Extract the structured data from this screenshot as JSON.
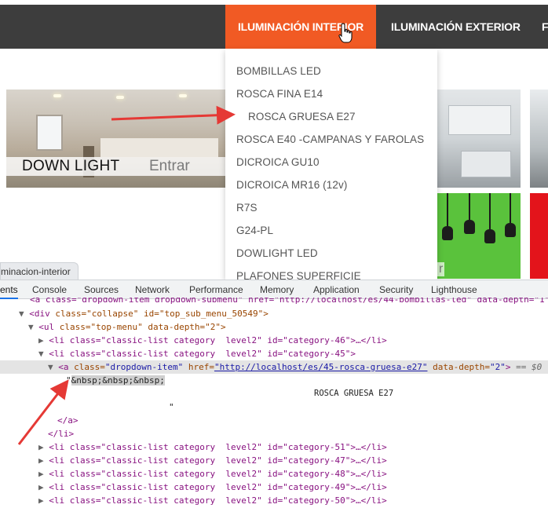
{
  "nav": {
    "items": [
      "ILUMINACIÓN INTERIOR",
      "ILUMINACIÓN EXTERIOR",
      "F"
    ],
    "active_color": "#f15a24",
    "bar_color": "#3d3d3d"
  },
  "tiles": {
    "downlight": {
      "title": "DOWN LIGHT",
      "enter": "Entrar"
    },
    "bulbs_caption": "r"
  },
  "dropdown": {
    "items": [
      "BOMBILLAS LED",
      "ROSCA FINA E14",
      "ROSCA GRUESA E27",
      "ROSCA E40 -CAMPANAS Y FAROLAS",
      "DICROICA GU10",
      "DICROICA MR16 (12v)",
      "R7S",
      "G24-PL",
      "DOWLIGHT LED",
      "PLAFONES SUPERFICIE"
    ]
  },
  "devtools": {
    "url_tab": "minacion-interior",
    "tabs": [
      "ents",
      "Console",
      "Sources",
      "Network",
      "Performance",
      "Memory",
      "Application",
      "Security",
      "Lighthouse"
    ],
    "lines": {
      "l0": "<a class=\"dropdown-item dropdown-submenu\" href=\"http://localhost/es/44-bombillas-led\" data-depth=\"1\" d",
      "l1_tag": "<div",
      "l1_attrs": " class=\"collapse\" id=\"top_sub_menu_50549\">",
      "l2_tag": "<ul",
      "l2_attrs": " class=\"top-menu\" data-depth=\"2\">",
      "li46": "<li class=\"classic-list category  level2\" id=\"category-46\">…</li>",
      "li45": "<li class=\"classic-list category  level2\" id=\"category-45\">",
      "a_open": "<a",
      "a_class_attr": " class=",
      "a_class_val": "\"dropdown-item\"",
      "a_href_attr": " href=",
      "a_href_val": "\"http://localhost/es/45-rosca-gruesa-e27\"",
      "a_depth_attr": " data-depth=",
      "a_depth_val": "\"2\"",
      "a_close": ">",
      "a_eq": " == $0",
      "text_quote_open": "\"",
      "nbsp": "&nbsp;&nbsp;&nbsp;",
      "text_value": "ROSCA GRUESA E27",
      "text_quote_close": "\"",
      "a_end": "</a>",
      "li_end": "</li>",
      "li51": "<li class=\"classic-list category  level2\" id=\"category-51\">…</li>",
      "li47": "<li class=\"classic-list category  level2\" id=\"category-47\">…</li>",
      "li48": "<li class=\"classic-list category  level2\" id=\"category-48\">…</li>",
      "li49": "<li class=\"classic-list category  level2\" id=\"category-49\">…</li>",
      "li50": "<li class=\"classic-list category  level2\" id=\"category-50\">…</li>"
    }
  },
  "annotation_color": "#e53935"
}
